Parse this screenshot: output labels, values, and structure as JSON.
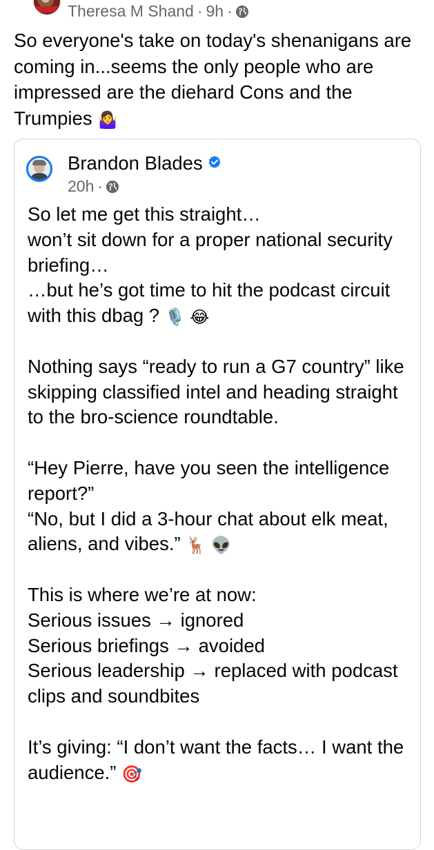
{
  "top_post": {
    "author": "Theresa M Shand",
    "time": "9h",
    "separator": "·",
    "audience_icon": "globe-icon",
    "text": "So everyone's take on today's shenanigans are coming in...seems the only people who are impressed are the diehard Cons and the Trumpies",
    "emoji": "🤷‍♀️"
  },
  "shared_post": {
    "author": "Brandon Blades",
    "verified_icon": "verified-badge-icon",
    "time": "20h",
    "separator": "·",
    "audience_icon": "globe-icon",
    "paragraphs": [
      "So let me get this straight…\nwon’t sit down for a proper national security briefing…\n…but he’s got time to hit the podcast circuit with this dbag ?",
      "Nothing says “ready to run a G7 country” like skipping classified intel and heading straight to the bro-science roundtable.",
      "“Hey Pierre, have you seen the intelligence report?”\n“No, but I did a 3-hour chat about elk meat, aliens, and vibes.”",
      "This is where we’re at now:\nSerious issues → ignored\nSerious briefings → avoided\nSerious leadership → replaced with podcast clips and soundbites",
      "It’s giving: “I don’t want the facts… I want the audience.”"
    ],
    "emojis": {
      "p1": "🎙️ 😂",
      "p3": "🦌 👽",
      "p5": "🎯"
    }
  },
  "colors": {
    "text": "#050505",
    "secondary_text": "#65676b",
    "card_border": "#d0d3d8",
    "verified_blue": "#1877f2"
  }
}
